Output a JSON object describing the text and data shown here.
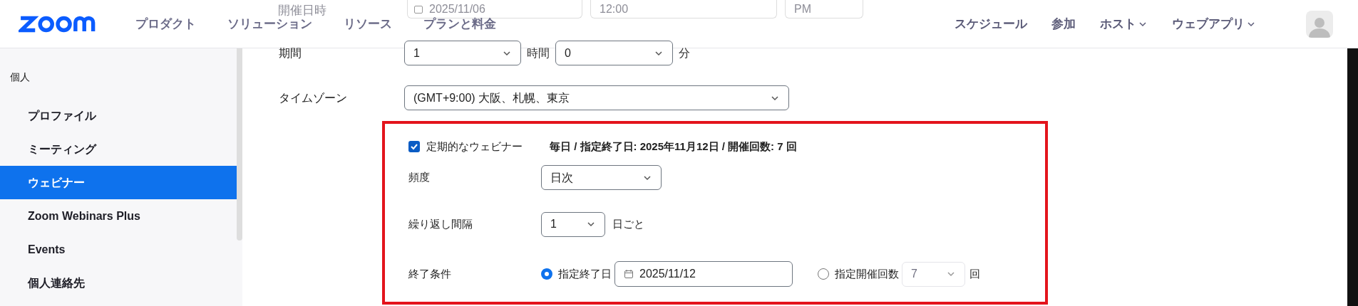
{
  "header": {
    "nav": [
      "プロダクト",
      "ソリューション",
      "リソース",
      "プランと料金"
    ],
    "right_nav": [
      {
        "label": "スケジュール",
        "dropdown": false
      },
      {
        "label": "参加",
        "dropdown": false
      },
      {
        "label": "ホスト",
        "dropdown": true
      },
      {
        "label": "ウェブアプリ",
        "dropdown": true
      }
    ],
    "behind": {
      "label": "開催日時",
      "date": "2025/11/06",
      "time": "12:00",
      "ampm": "PM"
    }
  },
  "sidebar": {
    "section": "個人",
    "items": [
      {
        "label": "プロファイル",
        "selected": false
      },
      {
        "label": "ミーティング",
        "selected": false
      },
      {
        "label": "ウェビナー",
        "selected": true
      },
      {
        "label": "Zoom Webinars Plus",
        "selected": false
      },
      {
        "label": "Events",
        "selected": false
      },
      {
        "label": "個人連絡先",
        "selected": false
      }
    ]
  },
  "form": {
    "duration": {
      "label": "期間",
      "hours": "1",
      "hours_unit": "時間",
      "minutes": "0",
      "minutes_unit": "分"
    },
    "timezone": {
      "label": "タイムゾーン",
      "value": "(GMT+9:00) 大阪、札幌、東京"
    },
    "recurring": {
      "label": "定期的なウェビナー",
      "checked": true,
      "summary": "毎日 / 指定終了日: 2025年11月12日 / 開催回数: 7 回",
      "frequency": {
        "label": "頻度",
        "value": "日次"
      },
      "interval": {
        "label": "繰り返し間隔",
        "value": "1",
        "unit": "日ごと"
      },
      "end": {
        "label": "終了条件",
        "options": [
          {
            "label": "指定終了日",
            "selected": true,
            "kind": "date",
            "value": "2025/11/12"
          },
          {
            "label": "指定開催回数",
            "selected": false,
            "kind": "count",
            "value": "7",
            "unit": "回"
          }
        ]
      }
    }
  }
}
